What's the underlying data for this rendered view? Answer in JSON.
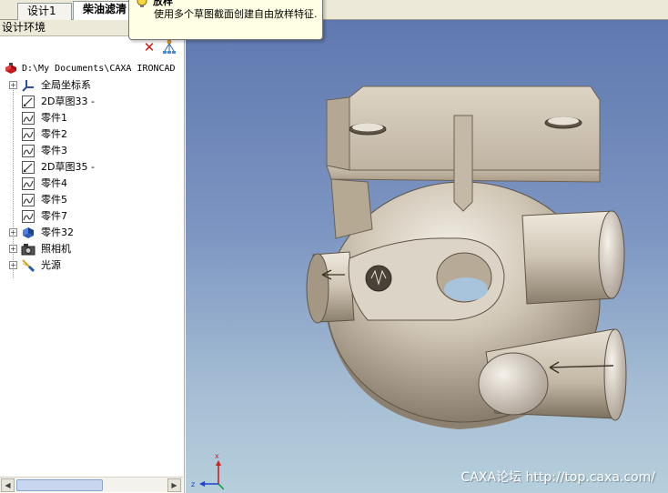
{
  "tabs": [
    {
      "label": "设计1"
    },
    {
      "label": "柴油滤清"
    }
  ],
  "pane": {
    "title": "设计环境"
  },
  "tree": {
    "root": {
      "label": "D:\\My Documents\\CAXA IRONCAD",
      "icon": "document-icon"
    },
    "items": [
      {
        "label": "全局坐标系",
        "icon": "coordinate-system-icon",
        "expandable": true
      },
      {
        "label": "2D草图33 -",
        "icon": "sketch-icon",
        "expandable": false
      },
      {
        "label": "零件1",
        "icon": "part-icon",
        "expandable": false
      },
      {
        "label": "零件2",
        "icon": "part-icon",
        "expandable": false
      },
      {
        "label": "零件3",
        "icon": "part-icon",
        "expandable": false
      },
      {
        "label": "2D草图35 -",
        "icon": "sketch-icon",
        "expandable": false
      },
      {
        "label": "零件4",
        "icon": "part-icon",
        "expandable": false
      },
      {
        "label": "零件5",
        "icon": "part-icon",
        "expandable": false
      },
      {
        "label": "零件7",
        "icon": "part-icon",
        "expandable": false
      },
      {
        "label": "零件32",
        "icon": "solid-part-icon",
        "expandable": true
      },
      {
        "label": "照相机",
        "icon": "camera-icon",
        "expandable": true
      },
      {
        "label": "光源",
        "icon": "light-icon",
        "expandable": true
      }
    ]
  },
  "tooltip": {
    "title": "放样",
    "body": "使用多个草图截面创建自由放样特征."
  },
  "triad": {
    "x": "x",
    "z": "z"
  },
  "watermark": "CAXA论坛 http://top.caxa.com/",
  "colors": {
    "viewport_top": "#5f78b0",
    "viewport_bottom": "#b6cfdc",
    "model_base": "#c9bfae"
  }
}
